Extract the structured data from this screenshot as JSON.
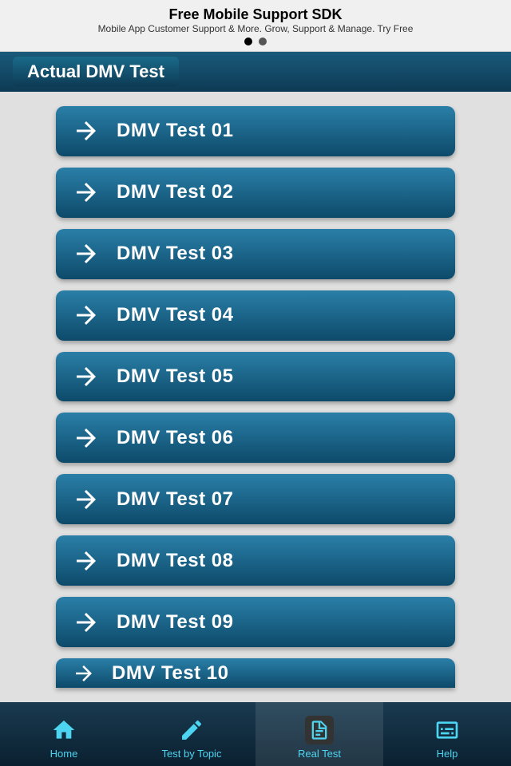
{
  "ad": {
    "title": "Free Mobile Support SDK",
    "subtitle": "Mobile App Customer Support & More. Grow, Support & Manage. Try Free",
    "dot1_active": true,
    "dot2_active": false
  },
  "header": {
    "title": "Actual DMV Test"
  },
  "tests": [
    {
      "label": "DMV Test 01"
    },
    {
      "label": "DMV Test 02"
    },
    {
      "label": "DMV Test 03"
    },
    {
      "label": "DMV Test 04"
    },
    {
      "label": "DMV Test 05"
    },
    {
      "label": "DMV Test 06"
    },
    {
      "label": "DMV Test 07"
    },
    {
      "label": "DMV Test 08"
    },
    {
      "label": "DMV Test 09"
    },
    {
      "label": "DMV Test 10"
    }
  ],
  "nav": {
    "items": [
      {
        "id": "home",
        "label": "Home",
        "active": false
      },
      {
        "id": "test-by-topic",
        "label": "Test by Topic",
        "active": false
      },
      {
        "id": "real-test",
        "label": "Real Test",
        "active": true
      },
      {
        "id": "help",
        "label": "Help",
        "active": false
      }
    ]
  }
}
